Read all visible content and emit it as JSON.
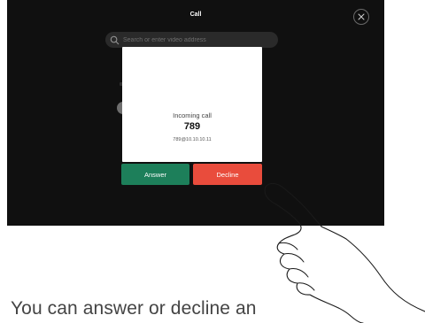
{
  "screen": {
    "title": "Call",
    "search": {
      "placeholder": "Search or enter video address"
    }
  },
  "incoming_call": {
    "label": "Incoming call",
    "number": "789",
    "address": "789@10.10.10.11",
    "answer_label": "Answer",
    "decline_label": "Decline"
  },
  "caption": {
    "text": "You can answer or decline an"
  },
  "colors": {
    "answer": "#1d7f5a",
    "decline": "#e94c3c",
    "screen_bg": "#101010"
  },
  "icons": {
    "close": "close-icon",
    "search": "search-icon",
    "hand": "pointing-hand-icon"
  }
}
